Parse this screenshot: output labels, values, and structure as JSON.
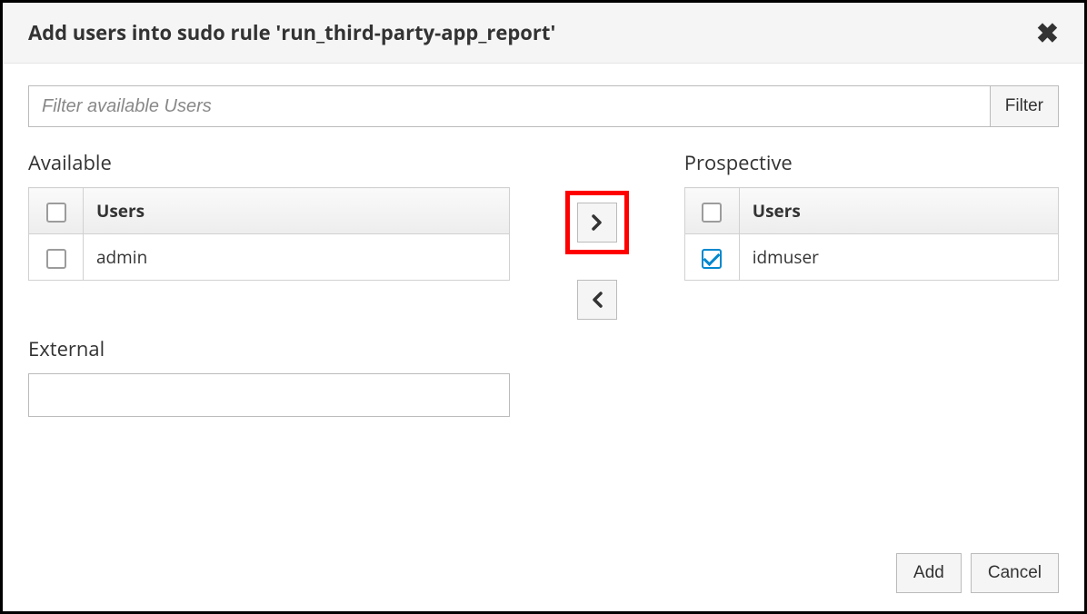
{
  "modal": {
    "title": "Add users into sudo rule 'run_third-party-app_report'"
  },
  "filter": {
    "placeholder": "Filter available Users",
    "button_label": "Filter"
  },
  "available": {
    "label": "Available",
    "column_header": "Users",
    "rows": [
      {
        "name": "admin",
        "checked": false
      }
    ]
  },
  "prospective": {
    "label": "Prospective",
    "column_header": "Users",
    "rows": [
      {
        "name": "idmuser",
        "checked": true
      }
    ]
  },
  "external": {
    "label": "External",
    "value": ""
  },
  "footer": {
    "add_label": "Add",
    "cancel_label": "Cancel"
  }
}
